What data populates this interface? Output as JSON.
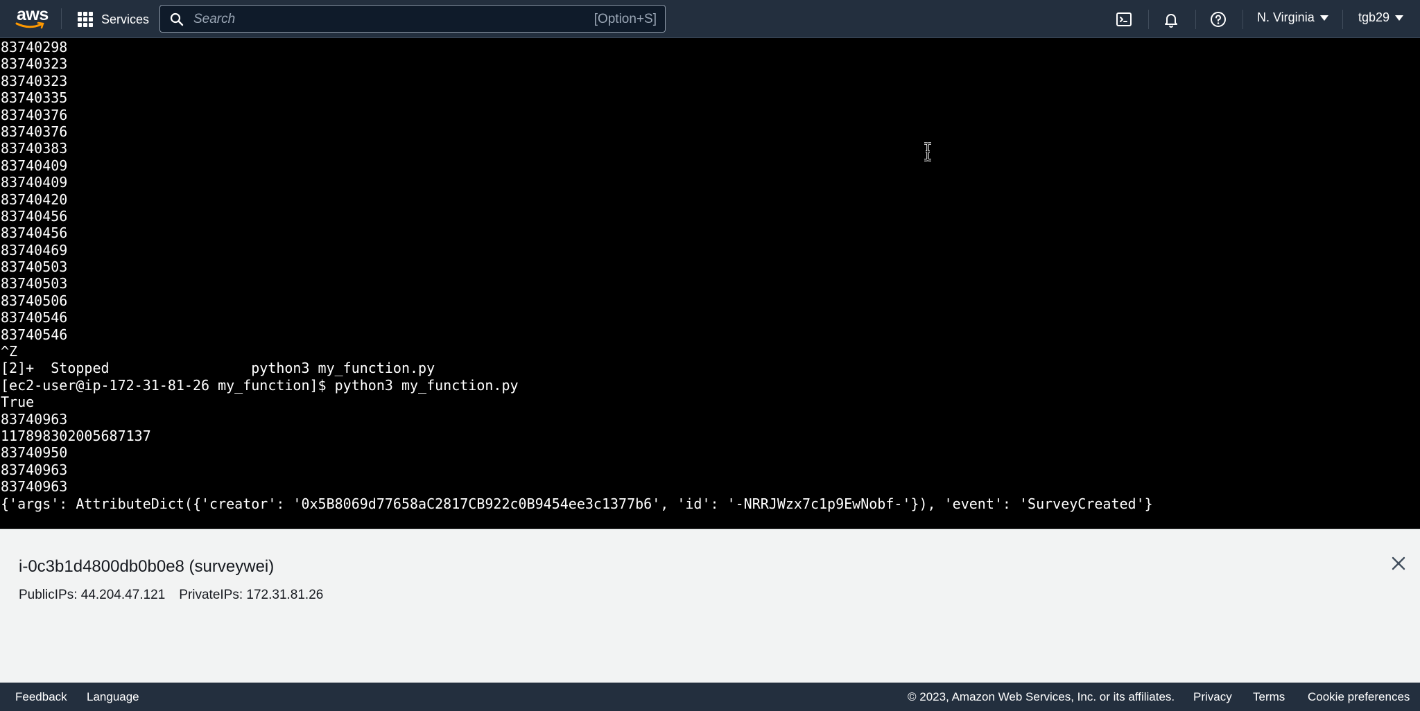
{
  "nav": {
    "logo_text": "aws",
    "services_label": "Services",
    "search_placeholder": "Search",
    "search_shortcut": "[Option+S]",
    "region": "N. Virginia",
    "user": "tgb29",
    "icons": [
      "cloudshell-icon",
      "bell-icon",
      "help-icon"
    ]
  },
  "terminal": {
    "lines": [
      "83740298",
      "83740323",
      "83740323",
      "83740335",
      "83740376",
      "83740376",
      "83740383",
      "83740409",
      "83740409",
      "83740420",
      "83740456",
      "83740456",
      "83740469",
      "83740503",
      "83740503",
      "83740506",
      "83740546",
      "83740546",
      "^Z",
      "[2]+  Stopped                 python3 my_function.py",
      "[ec2-user@ip-172-31-81-26 my_function]$ python3 my_function.py",
      "True",
      "83740963",
      "117898302005687137",
      "83740950",
      "83740963",
      "83740963",
      "{'args': AttributeDict({'creator': '0x5B8069d77658aC2817CB922c0B9454ee3c1377b6', 'id': '-NRRJWzx7c1p9EwNobf-'}), 'event': 'SurveyCreated'}"
    ]
  },
  "instance": {
    "title": "i-0c3b1d4800db0b0e8 (surveywei)",
    "public_ips": "PublicIPs: 44.204.47.121",
    "private_ips": "PrivateIPs: 172.31.81.26"
  },
  "footer": {
    "feedback": "Feedback",
    "language": "Language",
    "copyright": "© 2023, Amazon Web Services, Inc. or its affiliates.",
    "privacy": "Privacy",
    "terms": "Terms",
    "cookie": "Cookie preferences"
  },
  "colors": {
    "nav_bg": "#232f3e",
    "terminal_bg": "#000000",
    "terminal_fg": "#ffffff",
    "panel_bg": "#f2f3f3",
    "accent": "#ff9900"
  }
}
